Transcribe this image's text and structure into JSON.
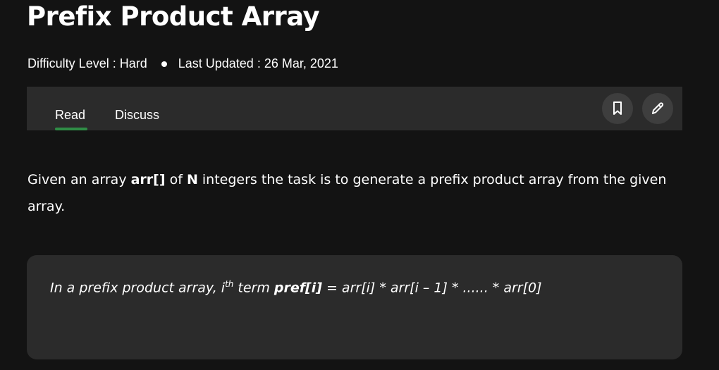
{
  "article": {
    "title": "Prefix Product Array",
    "difficulty": "Difficulty Level : Hard",
    "last_updated": "Last Updated : 26 Mar, 2021"
  },
  "tabs": {
    "read": "Read",
    "discuss": "Discuss",
    "active": "Read"
  },
  "toolbar_icons": [
    "bookmark-icon",
    "pencil-icon"
  ],
  "body": {
    "p1_a": "Given an array ",
    "p1_arr": "arr[]",
    "p1_b": " of ",
    "p1_n": "N",
    "p1_c": " integers the task is to generate a prefix product array from the given array."
  },
  "note": {
    "pre": "In a prefix product array, i",
    "sup": "th",
    "mid": " term ",
    "bold": "pref[i]",
    "post": " = arr[i] * arr[i – 1] * ...... * arr[0]"
  },
  "colors": {
    "background": "#131313",
    "panel": "#2b2b2b",
    "icon_button": "#3e3e3e",
    "accent_green": "#2f8d46",
    "text": "#ffffff"
  }
}
